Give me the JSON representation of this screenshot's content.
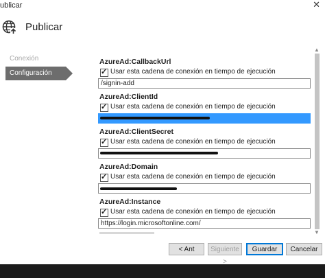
{
  "window": {
    "title": "ublicar",
    "close_glyph": "✕"
  },
  "header": {
    "title": "Publicar",
    "icon": "globe-publish-icon"
  },
  "nav": {
    "items": [
      {
        "label": "Conexión",
        "state": "disabled"
      },
      {
        "label": "Configuración",
        "state": "active"
      }
    ]
  },
  "content": {
    "sections": [
      {
        "name": "AzureAd:CallbackUrl",
        "checkbox_label": "Usar esta cadena de conexión en tiempo de ejecución",
        "checked": true,
        "value": "/signin-add",
        "redacted": false
      },
      {
        "name": "AzureAd:ClientId",
        "checkbox_label": "Usar esta cadena de conexión en tiempo de ejecución",
        "checked": true,
        "value": "",
        "redacted": true,
        "selected": true
      },
      {
        "name": "AzureAd:ClientSecret",
        "checkbox_label": "Usar esta cadena de conexión en tiempo de ejecución",
        "checked": true,
        "value": "",
        "redacted": true
      },
      {
        "name": "AzureAd:Domain",
        "checkbox_label": "Usar esta cadena de conexión en tiempo de ejecución",
        "checked": true,
        "value": "",
        "redacted": true
      },
      {
        "name": "AzureAd:Instance",
        "checkbox_label": "Usar esta cadena de conexión en tiempo de ejecución",
        "checked": true,
        "value": "https://login.microsoftonline.com/",
        "redacted": false
      }
    ]
  },
  "buttons": {
    "prev": "< Ant",
    "next": "Siguiente >",
    "save": "Guardar",
    "cancel": "Cancelar"
  },
  "colors": {
    "nav_active": "#6d6d6d",
    "selection": "#3399ff",
    "accent": "#0078d7"
  }
}
